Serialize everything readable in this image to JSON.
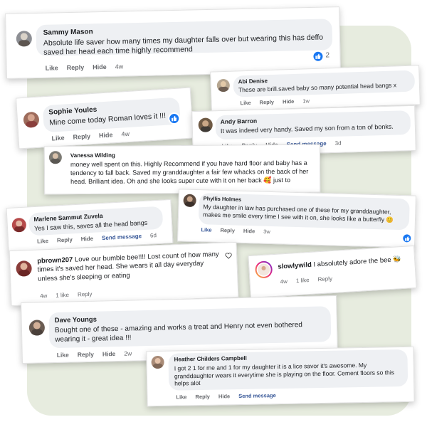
{
  "comments": {
    "sammy": {
      "name": "Sammy Mason",
      "text": "Absolute life saver how many times my daughter falls over but wearing this has deffo saved her head each time highly recommend",
      "like": "Like",
      "reply": "Reply",
      "hide": "Hide",
      "time": "4w",
      "reaction_count": "2"
    },
    "abi": {
      "name": "Abi Denise",
      "text": "These are brill.saved baby so many potential head bangs x",
      "like": "Like",
      "reply": "Reply",
      "hide": "Hide",
      "time": "1w"
    },
    "sophie": {
      "name": "Sophie Youles",
      "text": "Mine come today Roman loves it !!!",
      "like": "Like",
      "reply": "Reply",
      "hide": "Hide",
      "time": "4w"
    },
    "andy": {
      "name": "Andy Barron",
      "text": "It was indeed very handy. Saved my son from a ton of bonks.",
      "like": "Like",
      "reply": "Reply",
      "hide": "Hide",
      "send": "Send message",
      "time": "3d"
    },
    "vanessa": {
      "name": "Vanessa Wilding",
      "text": "money well spent on this. Highly Recommend if you have hard floor and baby has a tendency to fall back. Saved my granddaughter a fair few whacks on the back of her head. Brilliant idea. Oh and she looks super cute with it on her back 🥰 just to"
    },
    "marlene": {
      "name": "Marlene Sammut Zuvela",
      "text": "Yes I saw this, saves all the head bangs",
      "like": "Like",
      "reply": "Reply",
      "hide": "Hide",
      "send": "Send message",
      "time": "6d"
    },
    "phyllis": {
      "name": "Phyllis Holmes",
      "text": "My daughter in law has purchased one of these for my granddaughter, makes me smile every time I see with it on, she looks like a butterfly 😊",
      "like": "Like",
      "reply": "Reply",
      "hide": "Hide",
      "time": "3w"
    },
    "pbrown": {
      "name": "pbrown207",
      "text": "Love our bumble bee!!!! Lost count of how many times it's saved her head. She wears it all day everyday unless she's sleeping or eating",
      "time": "4w",
      "likes": "1 like",
      "reply": "Reply"
    },
    "slowly": {
      "name": "slowlywild",
      "text": "I absolutely adore the bee 🐝",
      "time": "4w",
      "likes": "1 like",
      "reply": "Reply"
    },
    "dave": {
      "name": "Dave Youngs",
      "text": "Bought one of these - amazing and works a treat and Henry not even bothered wearing it - great idea !!!",
      "like": "Like",
      "reply": "Reply",
      "hide": "Hide",
      "time": "2w"
    },
    "heather": {
      "name": "Heather Childers Campbell",
      "text": "I got 2 1 for me and 1 for my daughter it is a lice savor it's awesome. My granddaughter wears it everytime she is playing on the floor. Cement floors so this helps alot",
      "like": "Like",
      "reply": "Reply",
      "hide": "Hide",
      "send": "Send message"
    }
  },
  "colors": {
    "panel": "#e7ecdf",
    "bubble": "#eef0f3",
    "link": "#385898",
    "meta": "#65676b",
    "like_blue": "#1877f2"
  },
  "icons": {
    "reaction": "thumbs-up-icon",
    "heart": "heart-outline-icon"
  }
}
